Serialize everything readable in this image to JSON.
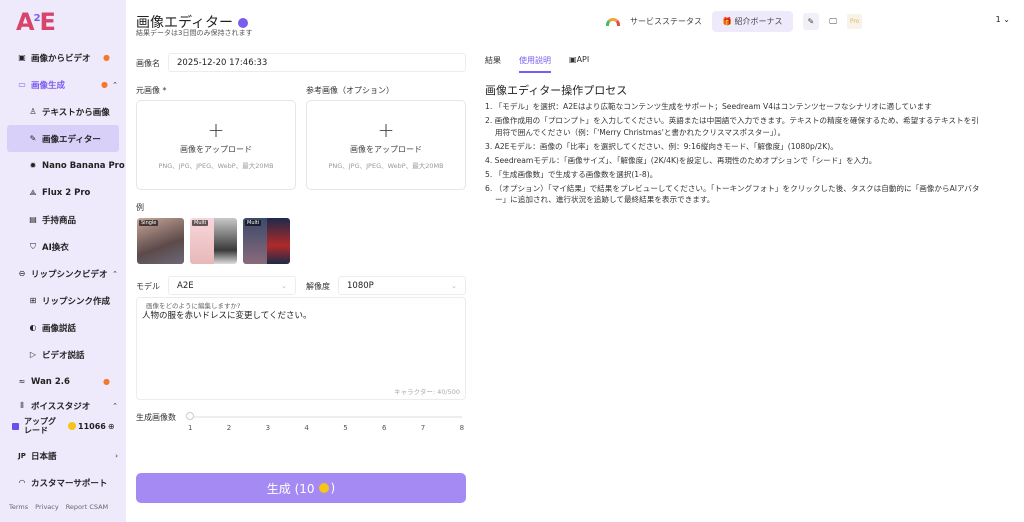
{
  "sidebar": {
    "logo": "A2E",
    "items": [
      {
        "label": "画像からビデオ",
        "icon": "image-video-icon",
        "fire": true
      },
      {
        "label": "画像生成",
        "icon": "image-icon",
        "fire": true,
        "expanded": true
      },
      {
        "label": "テキストから画像",
        "icon": "person-icon"
      },
      {
        "label": "画像エディター",
        "icon": "edit-icon",
        "active": true
      },
      {
        "label": "Nano Banana Pro",
        "icon": "gear-icon"
      },
      {
        "label": "Flux 2 Pro",
        "icon": "triangle-icon"
      },
      {
        "label": "手持商品",
        "icon": "box-icon"
      },
      {
        "label": "AI換衣",
        "icon": "shirt-icon"
      },
      {
        "label": "リップシンクビデオ",
        "icon": "lips-icon",
        "expanded": true
      },
      {
        "label": "リップシンク作成",
        "icon": "plus-square-icon"
      },
      {
        "label": "画像説話",
        "icon": "head-speak-icon"
      },
      {
        "label": "ビデオ説話",
        "icon": "video-speak-icon"
      },
      {
        "label": "Wan 2.6",
        "icon": "wan-icon",
        "fire": true
      },
      {
        "label": "ボイススタジオ",
        "icon": "waveform-icon",
        "expanded": true
      }
    ],
    "upgrade": "アップグレード",
    "credits": "11066",
    "language": "日本語",
    "language_code": "JP",
    "support": "カスタマーサポート",
    "footer": [
      "Terms",
      "Privacy",
      "Report CSAM"
    ]
  },
  "header": {
    "title": "画像エディター",
    "subtitle": "結果データは3日間のみ保持されます",
    "service_status": "サービスステータス",
    "referral": "紹介ボーナス",
    "pro": "Pro",
    "user": "1"
  },
  "form": {
    "image_name_label": "画像名",
    "image_name": "2025-12-20 17:46:33",
    "source_label": "元画像 *",
    "ref_label": "参考画像（オプション）",
    "upload_text": "画像をアップロード",
    "upload_hint": "PNG、JPG、JPEG、WebP、最大20MB",
    "examples_label": "例",
    "examples": [
      "Single",
      "Multi",
      "Multi"
    ],
    "model_label": "モデル",
    "model": "A2E",
    "resolution_label": "解像度",
    "resolution": "1080P",
    "prompt_placeholder": "画像をどのように編集しますか?",
    "prompt": "人物の服を赤いドレスに変更してください。",
    "char_count": "キャラクター: 40/500",
    "count_label": "生成画像数",
    "count_value": 1,
    "count_ticks": [
      "1",
      "2",
      "3",
      "4",
      "5",
      "6",
      "7",
      "8"
    ],
    "generate": "生成 (10",
    "generate_close": ")"
  },
  "right": {
    "tabs": [
      "結果",
      "使用説明",
      "API"
    ],
    "active_tab": "使用説明",
    "heading": "画像エディター操作プロセス",
    "steps": [
      "1. 「モデル」を選択：A2Eはより広範なコンテンツ生成をサポート；Seedream V4はコンテンツセーフなシナリオに適しています",
      "2. 画像作成用の「プロンプト」を入力してください。英語または中国語で入力できます。テキストの精度を確保するため、希望するテキストを引用符で囲んでください（例：「'Merry Christmas'と書かれたクリスマスポスター」）。",
      "3. A2Eモデル：画像の「比率」を選択してください、例：9:16縦向きモード、「解像度」(1080p/2K)。",
      "4. Seedreamモデル：「画像サイズ」、「解像度」(2K/4K)を設定し、再現性のためオプションで「シード」を入力。",
      "5. 「生成画像数」で生成する画像数を選択(1-8)。",
      "6. （オプション）「マイ結果」で結果をプレビューしてください。「トーキングフォト」をクリックした後、タスクは自動的に「画像からAIアバター」に追加され、進行状況を追跡して最終結果を表示できます。"
    ]
  },
  "colors": {
    "accent": "#7b5cf0",
    "sidebar_bg": "#eeeafc",
    "button": "#a48af2"
  }
}
